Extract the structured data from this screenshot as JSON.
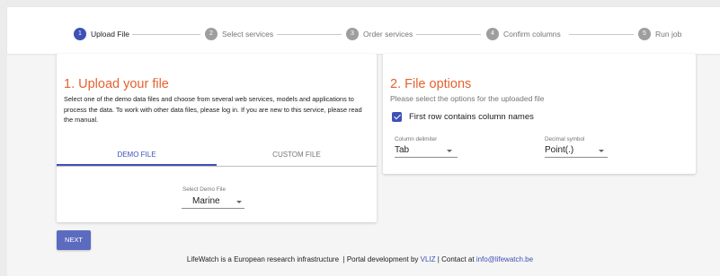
{
  "stepper": {
    "steps": [
      {
        "number": "1",
        "label": "Upload File",
        "active": true
      },
      {
        "number": "2",
        "label": "Select services",
        "active": false
      },
      {
        "number": "3",
        "label": "Order services",
        "active": false
      },
      {
        "number": "4",
        "label": "Confirm columns",
        "active": false
      },
      {
        "number": "5",
        "label": "Run job",
        "active": false
      }
    ]
  },
  "upload_card": {
    "title": "1. Upload your file",
    "description": "Select one of the demo data files and choose from several web services, models and applications to process the data. To work with other data files, please log in. If you are new to this service, please read the manual.",
    "tabs": [
      {
        "label": "DEMO FILE",
        "active": true
      },
      {
        "label": "CUSTOM FILE",
        "active": false
      }
    ],
    "demo_select": {
      "label": "Select Demo File",
      "value": "Marine"
    }
  },
  "options_card": {
    "title": "2. File options",
    "subtitle": "Please select the options for the uploaded file",
    "first_row_checkbox": {
      "label": "First row contains column names",
      "checked": true
    },
    "column_delimiter": {
      "label": "Column delimiter",
      "value": "Tab"
    },
    "decimal_symbol": {
      "label": "Decimal symbol",
      "value": "Point(.)"
    }
  },
  "next_button": {
    "label": "NEXT"
  },
  "footer": {
    "text_1": "LifeWatch is a European research infrastructure",
    "sep_1": "|",
    "text_2": "Portal development by",
    "vliz_link": "VLIZ",
    "sep_2": "|",
    "text_3": "Contact at",
    "email_link": "info@lifewatch.be"
  },
  "colors": {
    "accent": "#3f51b5",
    "title_orange": "#e4622f",
    "button": "#5c6bc0",
    "inactive_step": "#9e9e9e"
  }
}
